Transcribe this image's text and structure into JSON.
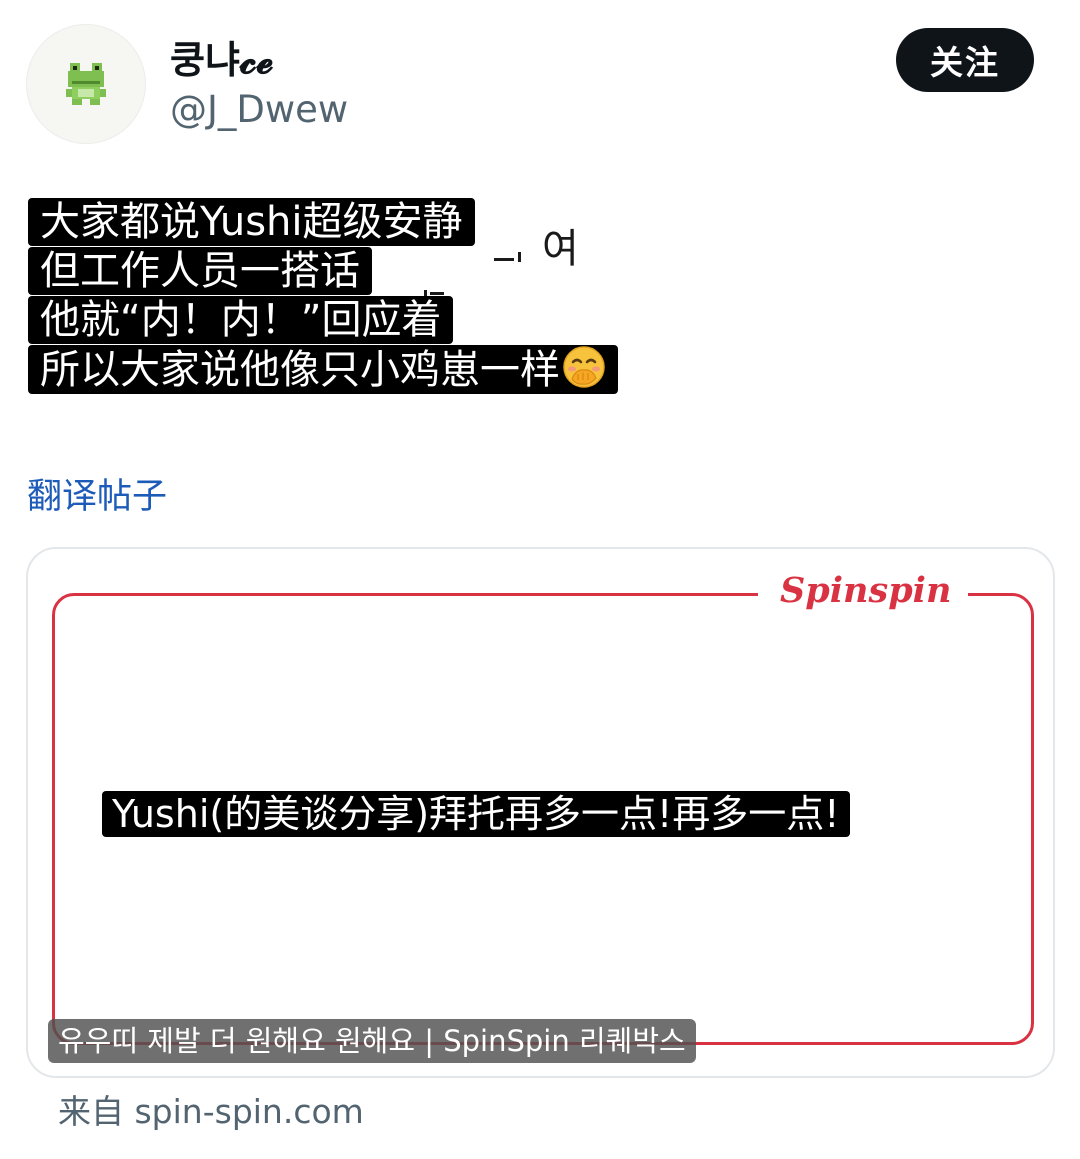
{
  "header": {
    "display_name": "쿵냐𝓬𝓮",
    "handle": "@J_Dwew",
    "follow_label": "关注"
  },
  "post": {
    "lines": [
      "大家都说Yushi超级安静",
      "但工作人员一搭话",
      "他就“内！内！”回应着",
      "所以大家说他像只小鸡崽一样"
    ],
    "background_fragment": "여",
    "emoji": "face-with-hand-over-mouth-icon"
  },
  "translate_label": "翻译帖子",
  "card": {
    "brand": "Spinspin",
    "headline": "Yushi(的美谈分享)拜托再多一点!再多一点!",
    "caption": "유우띠 제발 더 원해요 원해요 | SpinSpin 리퀘박스",
    "source": "来自 spin-spin.com"
  },
  "colors": {
    "brand_red": "#d93343",
    "link_blue": "#1d5bb8",
    "sticker_black": "#000000"
  }
}
